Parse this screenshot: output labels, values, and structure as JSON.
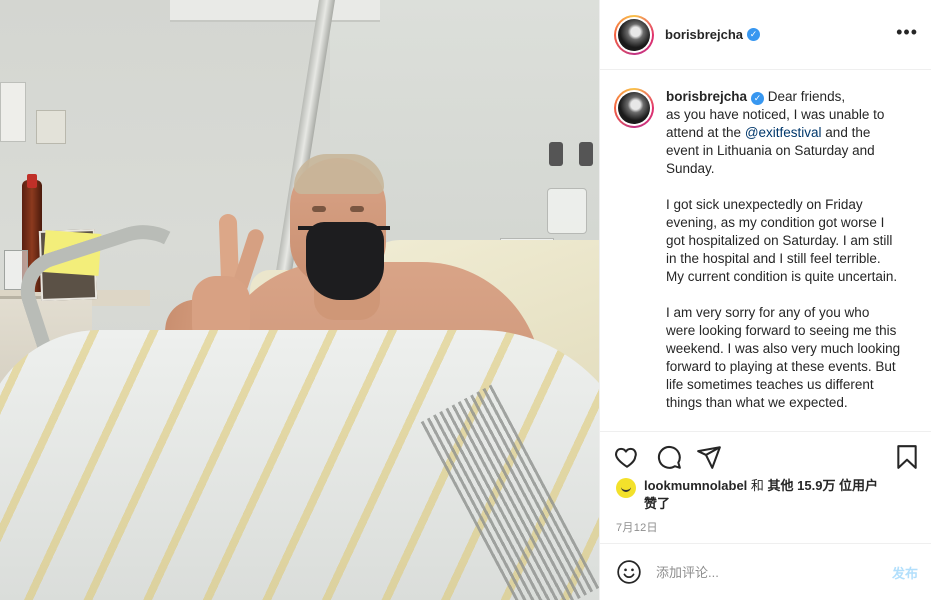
{
  "post": {
    "username": "borisbrejcha",
    "verified": true,
    "more_icon": "more-horizontal-icon",
    "photo_alt": "photo"
  },
  "caption": {
    "username": "borisbrejcha",
    "greeting": "Dear friends,",
    "line1_a": "as you have noticed, I was unable to attend at the ",
    "mention": "@exitfestival",
    "line1_b": " and the event in Lithuania on Saturday and Sunday.",
    "paragraph2": "I got sick unexpectedly on Friday evening, as my condition got worse I got hospitalized on Saturday. I am still in the hospital and I still feel terrible. My current condition is quite uncertain.",
    "paragraph3": "I am very sorry for any of you who were looking forward to seeing me this weekend. I was also very much looking forward to playing at these events. But life sometimes teaches us different things than what we expected."
  },
  "actions": {
    "like_icon": "heart-icon",
    "comment_icon": "comment-icon",
    "share_icon": "paper-plane-icon",
    "save_icon": "bookmark-icon"
  },
  "likes": {
    "liker": "lookmumnolabel",
    "and": " 和 ",
    "others": "其他 15.9万 位用户",
    "suffix": "赞了"
  },
  "date": "7月12日",
  "comment": {
    "placeholder": "添加评论...",
    "post_label": "发布",
    "emoji_icon": "smiley-icon"
  },
  "colors": {
    "accent_link": "#00376b",
    "verified": "#3897f0",
    "post_button_disabled": "#b2dffc",
    "muted_text": "#8e8e8e"
  }
}
